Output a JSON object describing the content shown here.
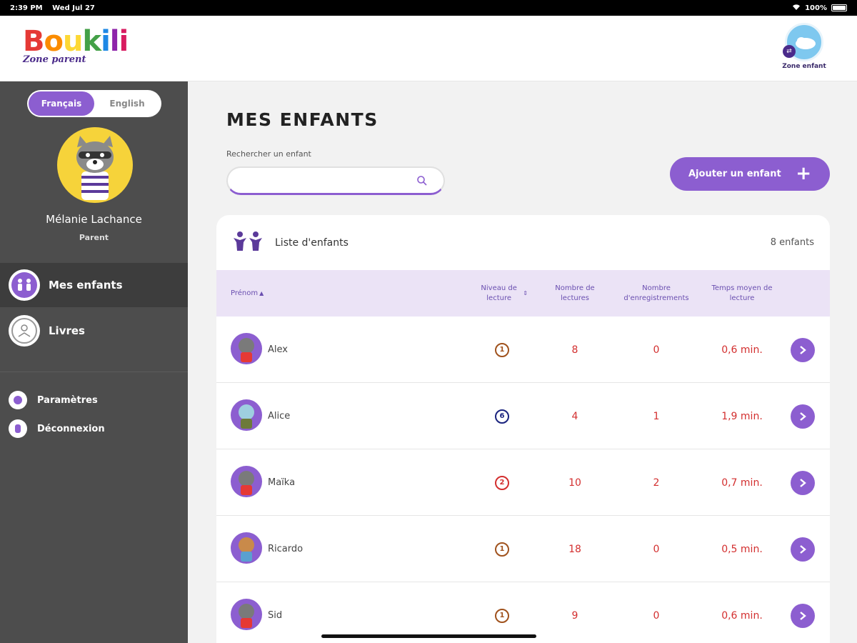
{
  "status_bar": {
    "time": "2:39 PM",
    "date": "Wed Jul 27",
    "battery": "100%"
  },
  "brand": {
    "name": "Boukili",
    "letters": [
      "B",
      "o",
      "u",
      "k",
      "i",
      "l",
      "i"
    ],
    "subtitle": "Zone parent"
  },
  "zone_enfant": {
    "label": "Zone enfant"
  },
  "language": {
    "options": [
      "Français",
      "English"
    ],
    "selected": "Français"
  },
  "user": {
    "name": "Mélanie Lachance",
    "role": "Parent"
  },
  "nav": [
    {
      "label": "Mes enfants",
      "icon": "children-icon",
      "active": true
    },
    {
      "label": "Livres",
      "icon": "reader-icon",
      "active": false
    }
  ],
  "secondary_nav": [
    {
      "label": "Paramètres",
      "icon": "settings-icon"
    },
    {
      "label": "Déconnexion",
      "icon": "logout-icon"
    }
  ],
  "page": {
    "title": "MES ENFANTS"
  },
  "search": {
    "label": "Rechercher un enfant",
    "value": "",
    "placeholder": ""
  },
  "add_child": {
    "label": "Ajouter un enfant"
  },
  "list": {
    "title": "Liste d'enfants",
    "count": "8 enfants",
    "columns": [
      "Prénom",
      "Niveau de lecture",
      "Nombre de lectures",
      "Nombre d'enregistrements",
      "Temps moyen de lecture"
    ],
    "rows": [
      {
        "name": "Alex",
        "level": "1",
        "level_color": "#a0521d",
        "readings": "8",
        "recordings": "0",
        "avg_time": "0,6 min."
      },
      {
        "name": "Alice",
        "level": "6",
        "level_color": "#1a237e",
        "readings": "4",
        "recordings": "1",
        "avg_time": "1,9 min."
      },
      {
        "name": "Maïka",
        "level": "2",
        "level_color": "#d32f2f",
        "readings": "10",
        "recordings": "2",
        "avg_time": "0,7 min."
      },
      {
        "name": "Ricardo",
        "level": "1",
        "level_color": "#a0521d",
        "readings": "18",
        "recordings": "0",
        "avg_time": "0,5 min."
      },
      {
        "name": "Sid",
        "level": "1",
        "level_color": "#a0521d",
        "readings": "9",
        "recordings": "0",
        "avg_time": "0,6 min."
      }
    ]
  },
  "colors": {
    "accent": "#8c5ed0",
    "sidebar": "#4d4d4d",
    "value_red": "#d32f2f",
    "header_row": "#ebe3f6"
  }
}
